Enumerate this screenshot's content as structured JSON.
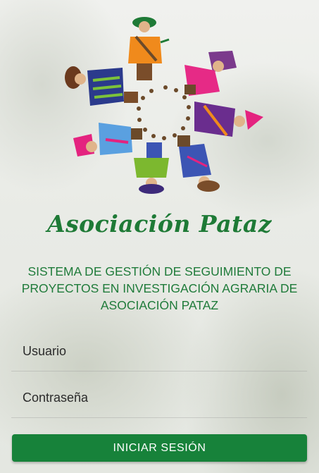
{
  "logo": {
    "text": "Asociación Pataz"
  },
  "subtitle": "SISTEMA DE GESTIÓN DE SEGUIMIENTO DE PROYECTOS EN INVESTIGACIÓN AGRARIA DE ASOCIACIÓN PATAZ",
  "form": {
    "username": {
      "placeholder": "Usuario",
      "value": ""
    },
    "password": {
      "placeholder": "Contraseña",
      "value": ""
    },
    "submit_label": "INICIAR SESIÓN"
  },
  "colors": {
    "brand_green": "#17823a",
    "text_green": "#1f7b3a"
  }
}
